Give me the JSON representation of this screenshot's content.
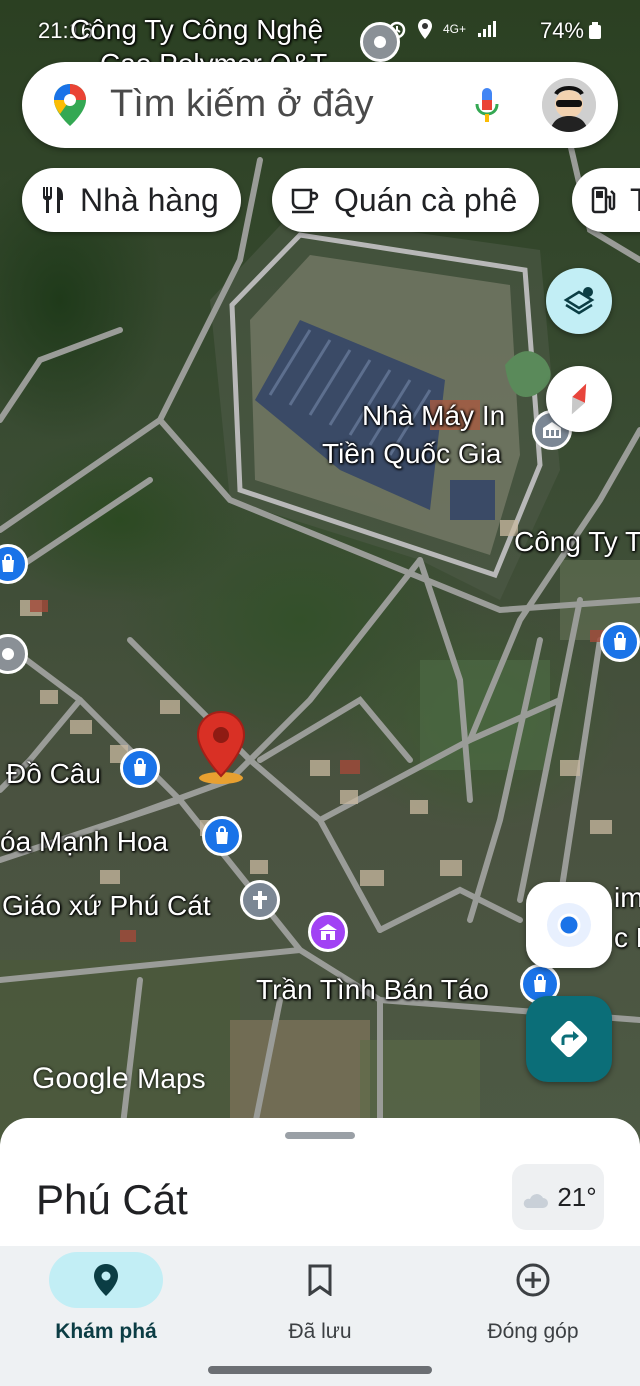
{
  "status_bar": {
    "time": "21:16",
    "battery": "74%",
    "network": "4G+"
  },
  "search": {
    "placeholder": "Tìm kiếm ở đây"
  },
  "chips": [
    {
      "label": "Nhà hàng",
      "icon": "restaurant-icon"
    },
    {
      "label": "Quán cà phê",
      "icon": "coffee-icon"
    },
    {
      "label": "T",
      "icon": "gas-station-icon"
    }
  ],
  "map_labels": {
    "top_company": "Công Ty Công Nghệ",
    "top_company_line2": "Cao Polymer O&T",
    "factory_line1": "Nhà Máy In",
    "factory_line2": "Tiền Quốc Gia",
    "company_right": "Công Ty T",
    "do_cau": "Đồ Câu",
    "manh_hoa": "óa Mạnh Hoa",
    "giao_xu": "Giáo xứ Phú Cát",
    "tran_tinh": "Trần Tình Bán Táo",
    "right_edge_1": "im",
    "right_edge_2": "c H",
    "watermark_google": "Google",
    "watermark_maps": "Maps"
  },
  "place": {
    "title": "Phú Cát",
    "temperature": "21°"
  },
  "bottom_nav": [
    {
      "label": "Khám phá",
      "icon": "explore-pin-icon",
      "active": true
    },
    {
      "label": "Đã lưu",
      "icon": "bookmark-icon",
      "active": false
    },
    {
      "label": "Đóng góp",
      "icon": "add-circle-icon",
      "active": false
    }
  ],
  "colors": {
    "accent_teal": "#0b6e78",
    "nav_active_bg": "#c2eef5",
    "pin_red": "#d93025",
    "shop_blue": "#1a73e8"
  }
}
